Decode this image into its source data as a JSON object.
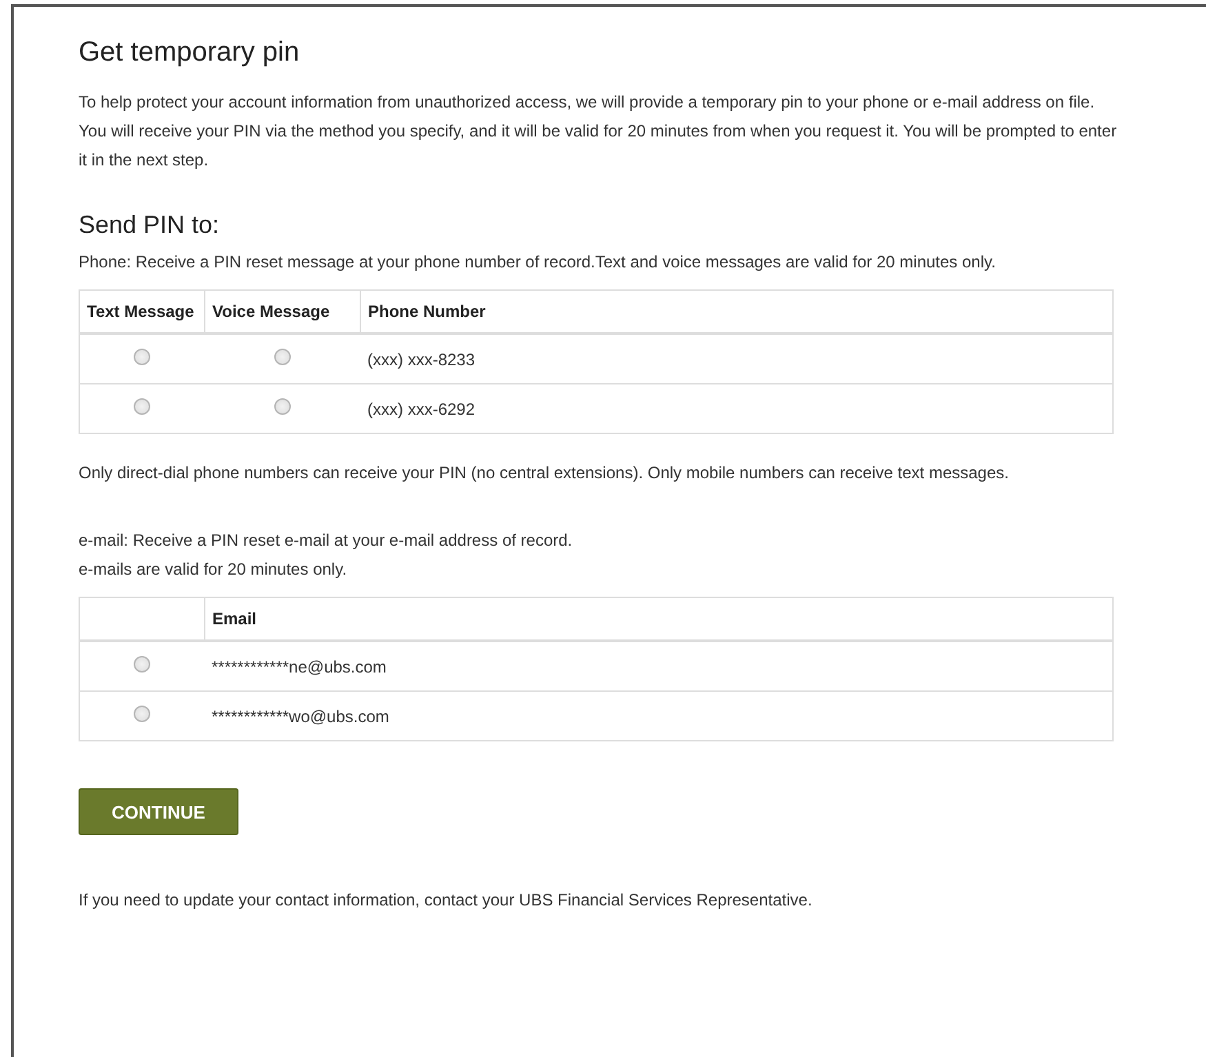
{
  "title": "Get temporary pin",
  "intro": "To help protect your account information from unauthorized access, we will provide a temporary pin to your phone or e-mail address on file. You will receive your PIN via the method you specify, and it will be valid for 20 minutes from when you request it. You will be prompted to enter it in the next step.",
  "send_heading": "Send PIN to:",
  "phone_note": "Phone: Receive a PIN reset message at your phone number of record.Text and voice messages are valid for 20 minutes only.",
  "phone_table": {
    "columns": [
      "Text Message",
      "Voice Message",
      "Phone Number"
    ],
    "rows": [
      {
        "text_selected": false,
        "voice_selected": false,
        "number": "(xxx) xxx-8233"
      },
      {
        "text_selected": false,
        "voice_selected": false,
        "number": "(xxx) xxx-6292"
      }
    ]
  },
  "phone_footnote": "Only direct-dial phone numbers can receive your PIN (no central extensions). Only mobile numbers can receive text messages.",
  "email_note": [
    "e-mail: Receive a PIN reset e-mail at your e-mail address of record.",
    "e-mails are valid for 20 minutes only."
  ],
  "email_table": {
    "columns": [
      "Email"
    ],
    "rows": [
      {
        "selected": false,
        "address": "************ne@ubs.com"
      },
      {
        "selected": false,
        "address": "************wo@ubs.com"
      }
    ]
  },
  "continue_button": "CONTINUE",
  "footer": "If you need to update your contact information, contact your UBS Financial Services Representative."
}
